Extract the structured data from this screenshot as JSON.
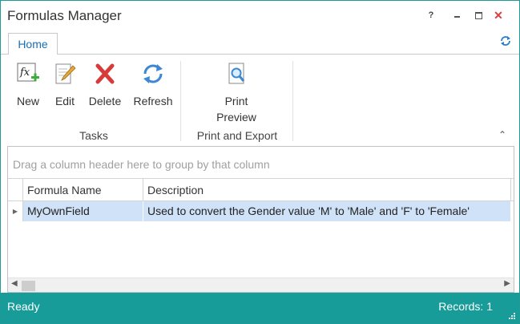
{
  "window": {
    "title": "Formulas Manager"
  },
  "titlebar": {
    "help_label": "?",
    "close_label": "✕"
  },
  "ribbon": {
    "tabs": [
      {
        "label": "Home"
      }
    ],
    "buttons": [
      {
        "label": "New",
        "icon": "formula-add-icon"
      },
      {
        "label": "Edit",
        "icon": "edit-pencil-icon"
      },
      {
        "label": "Delete",
        "icon": "delete-x-icon"
      },
      {
        "label": "Refresh",
        "icon": "refresh-icon"
      },
      {
        "label_line1": "Print",
        "label_line2": "Preview",
        "icon": "print-preview-icon"
      }
    ],
    "groups": [
      {
        "label": "Tasks"
      },
      {
        "label": "Print and Export"
      }
    ]
  },
  "grid": {
    "group_panel_text": "Drag a column header here to group by that column",
    "columns": [
      "Formula Name",
      "Description"
    ],
    "rows": [
      {
        "name": "MyOwnField",
        "description": "Used to convert the Gender value 'M' to 'Male' and 'F' to 'Female'"
      }
    ]
  },
  "status": {
    "left": "Ready",
    "right": "Records: 1"
  },
  "colors": {
    "accent": "#179c9a",
    "tab_text": "#1a6fb4",
    "selected_row": "#cfe2f7"
  }
}
